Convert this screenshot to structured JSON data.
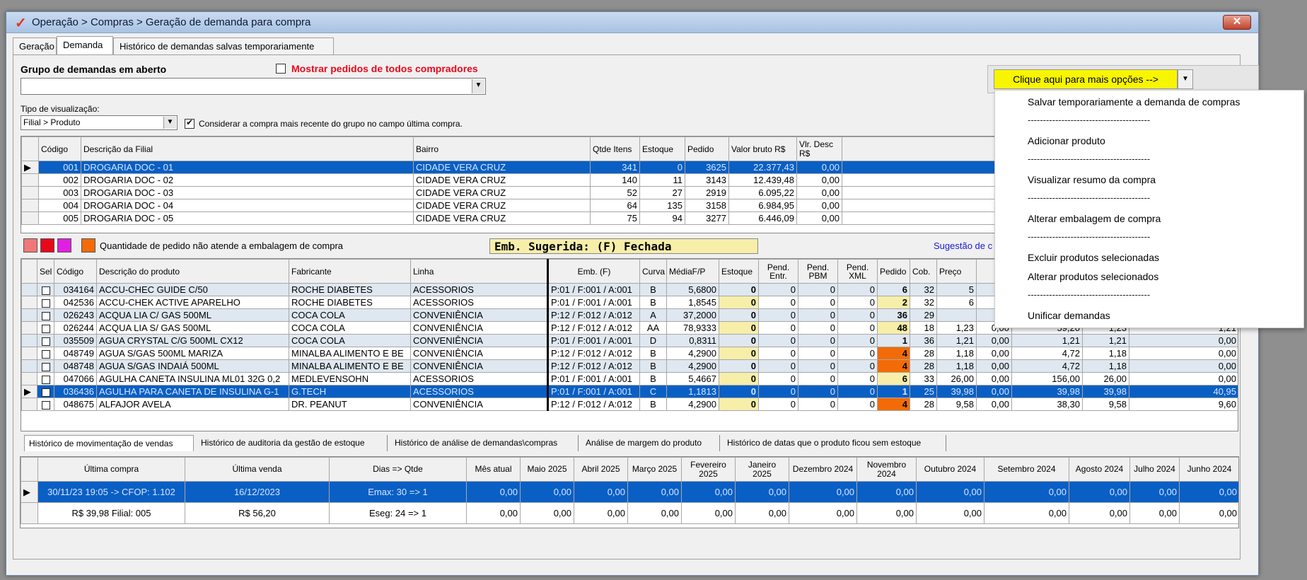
{
  "window": {
    "title": "Operação > Compras > Geração de demanda para compra",
    "close": "✕"
  },
  "tabs": [
    "Geração",
    "Demanda",
    "Histórico de demandas salvas temporariamente"
  ],
  "group": {
    "label": "Grupo de demandas em aberto",
    "show_all_label": "Mostrar pedidos de todos compradores",
    "value": ""
  },
  "view": {
    "label": "Tipo de visualização:",
    "value": "Filial > Produto",
    "consider_label": "Considerar a compra mais recente do grupo no campo última compra."
  },
  "options": {
    "button": "Clique aqui para mais opções -->",
    "menu": [
      "Salvar temporariamente a demanda de compras",
      "Adicionar produto",
      "Visualizar resumo da compra",
      "Alterar embalagem de compra",
      "Excluir produtos selecionadas",
      "Alterar produtos selecionados",
      "Unificar demandas"
    ],
    "separator": "----------------------------------------"
  },
  "filiais": {
    "headers": [
      "Código",
      "Descrição da Filial",
      "Bairro",
      "Qtde Itens",
      "Estoque",
      "Pedido",
      "Valor bruto R$",
      "Vlr. Desc R$"
    ],
    "rows": [
      [
        "001",
        "DROGARIA DOC - 01",
        "CIDADE VERA CRUZ",
        "341",
        "0",
        "3625",
        "22.377,43",
        "0,00"
      ],
      [
        "002",
        "DROGARIA DOC - 02",
        "CIDADE VERA CRUZ",
        "140",
        "11",
        "3143",
        "12.439,48",
        "0,00"
      ],
      [
        "003",
        "DROGARIA DOC - 03",
        "CIDADE VERA CRUZ",
        "52",
        "27",
        "2919",
        "6.095,22",
        "0,00"
      ],
      [
        "004",
        "DROGARIA DOC - 04",
        "CIDADE VERA CRUZ",
        "64",
        "135",
        "3158",
        "6.984,95",
        "0,00"
      ],
      [
        "005",
        "DROGARIA DOC - 05",
        "CIDADE VERA CRUZ",
        "75",
        "94",
        "3277",
        "6.446,09",
        "0,00"
      ]
    ]
  },
  "legend": {
    "text": "Quantidade de pedido não atende a embalagem de compra",
    "colors": [
      "#f07878",
      "#e8081b",
      "#e01fe0",
      "#f26b08"
    ]
  },
  "emb_sugerida": "Emb. Sugerida: (F) Fechada",
  "sugestao_label": "Sugestão de c",
  "produtos": {
    "headers": [
      "Sel",
      "Código",
      "Descrição do produto",
      "Fabricante",
      "Linha",
      "Emb. (F)",
      "Curva",
      "MédiaF/P",
      "Estoque",
      "Pend. Entr.",
      "Pend. PBM",
      "Pend. XML",
      "Pedido",
      "Cob.",
      "Preço",
      "",
      "",
      "",
      ""
    ],
    "rows": [
      [
        "034164",
        "ACCU-CHEC  GUIDE C/50",
        "ROCHE DIABETES",
        "ACESSORIOS",
        "P:01 / F:001 / A:001",
        "B",
        "5,6800",
        "0",
        "0",
        "0",
        "0",
        "6",
        "32",
        "5",
        "",
        "",
        "",
        ""
      ],
      [
        "042536",
        "ACCU-CHEK ACTIVE APARELHO",
        "ROCHE DIABETES",
        "ACESSORIOS",
        "P:01 / F:001 / A:001",
        "B",
        "1,8545",
        "0",
        "0",
        "0",
        "0",
        "2",
        "32",
        "6",
        "",
        "",
        "",
        ""
      ],
      [
        "026243",
        "ACQUA LIA C/ GAS 500ML",
        "COCA COLA",
        "CONVENIÊNCIA",
        "P:12 / F:012 / A:012",
        "A",
        "37,2000",
        "0",
        "0",
        "0",
        "0",
        "36",
        "29",
        "",
        "",
        "",
        "",
        ""
      ],
      [
        "026244",
        "ACQUA LIA S/ GAS 500ML",
        "COCA COLA",
        "CONVENIÊNCIA",
        "P:12 / F:012 / A:012",
        "AA",
        "78,9333",
        "0",
        "0",
        "0",
        "0",
        "48",
        "18",
        "1,23",
        "0,00",
        "59,20",
        "1,23",
        "1,21"
      ],
      [
        "035509",
        "AGUA CRYSTAL C/G 500ML CX12",
        "COCA COLA",
        "CONVENIÊNCIA",
        "P:01 / F:001 / A:001",
        "D",
        "0,8311",
        "0",
        "0",
        "0",
        "0",
        "1",
        "36",
        "1,21",
        "0,00",
        "1,21",
        "1,21",
        "0,00"
      ],
      [
        "048749",
        "AGUA S/GAS 500ML MARIZA",
        "MINALBA ALIMENTO E BE",
        "CONVENIÊNCIA",
        "P:12 / F:012 / A:012",
        "B",
        "4,2900",
        "0",
        "0",
        "0",
        "0",
        "4",
        "28",
        "1,18",
        "0,00",
        "4,72",
        "1,18",
        "0,00"
      ],
      [
        "048748",
        "AGUA S/GAS INDAIÁ 500ML",
        "MINALBA ALIMENTO E BE",
        "CONVENIÊNCIA",
        "P:12 / F:012 / A:012",
        "B",
        "4,2900",
        "0",
        "0",
        "0",
        "0",
        "4",
        "28",
        "1,18",
        "0,00",
        "4,72",
        "1,18",
        "0,00"
      ],
      [
        "047066",
        "AGULHA CANETA INSULINA ML01 32G 0,2",
        "MEDLEVENSOHN",
        "ACESSORIOS",
        "P:01 / F:001 / A:001",
        "B",
        "5,4667",
        "0",
        "0",
        "0",
        "0",
        "6",
        "33",
        "26,00",
        "0,00",
        "156,00",
        "26,00",
        "0,00"
      ],
      [
        "036436",
        "AGULHA PARA CANETA DE INSULINA G-1",
        "G.TECH",
        "ACESSORIOS",
        "P:01 / F:001 / A:001",
        "C",
        "1,1813",
        "0",
        "0",
        "0",
        "0",
        "1",
        "25",
        "39,98",
        "0,00",
        "39,98",
        "39,98",
        "40,95"
      ],
      [
        "048675",
        "ALFAJOR AVELA",
        "DR. PEANUT",
        "CONVENIÊNCIA",
        "P:12 / F:012 / A:012",
        "B",
        "4,2900",
        "0",
        "0",
        "0",
        "0",
        "4",
        "28",
        "9,58",
        "0,00",
        "38,30",
        "9,58",
        "9,60"
      ]
    ]
  },
  "bottom_tabs": [
    "Histórico de movimentação de vendas",
    "Histórico de auditoria da gestão de estoque",
    "Histórico de análise de demandas\\compras",
    "Análise de margem do produto",
    "Histórico de datas que o produto ficou sem estoque"
  ],
  "historico": {
    "headers": [
      "Última compra",
      "Última venda",
      "Dias => Qtde",
      "Mês atual",
      "Maio 2025",
      "Abril 2025",
      "Março 2025",
      "Fevereiro 2025",
      "Janeiro 2025",
      "Dezembro 2024",
      "Novembro 2024",
      "Outubro 2024",
      "Setembro 2024",
      "Agosto 2024",
      "Julho 2024",
      "Junho 2024"
    ],
    "rows": [
      [
        "30/11/23 19:05 -> CFOP: 1.102",
        "16/12/2023",
        "Emax: 30 => 1",
        "0,00",
        "0,00",
        "0,00",
        "0,00",
        "0,00",
        "0,00",
        "0,00",
        "0,00",
        "0,00",
        "0,00",
        "0,00",
        "0,00",
        "0,00"
      ],
      [
        "R$ 39,98 Filial: 005",
        "R$ 56,20",
        "Eseg: 24 => 1",
        "0,00",
        "0,00",
        "0,00",
        "0,00",
        "0,00",
        "0,00",
        "0,00",
        "0,00",
        "0,00",
        "0,00",
        "0,00",
        "0,00",
        "0,00"
      ]
    ]
  }
}
